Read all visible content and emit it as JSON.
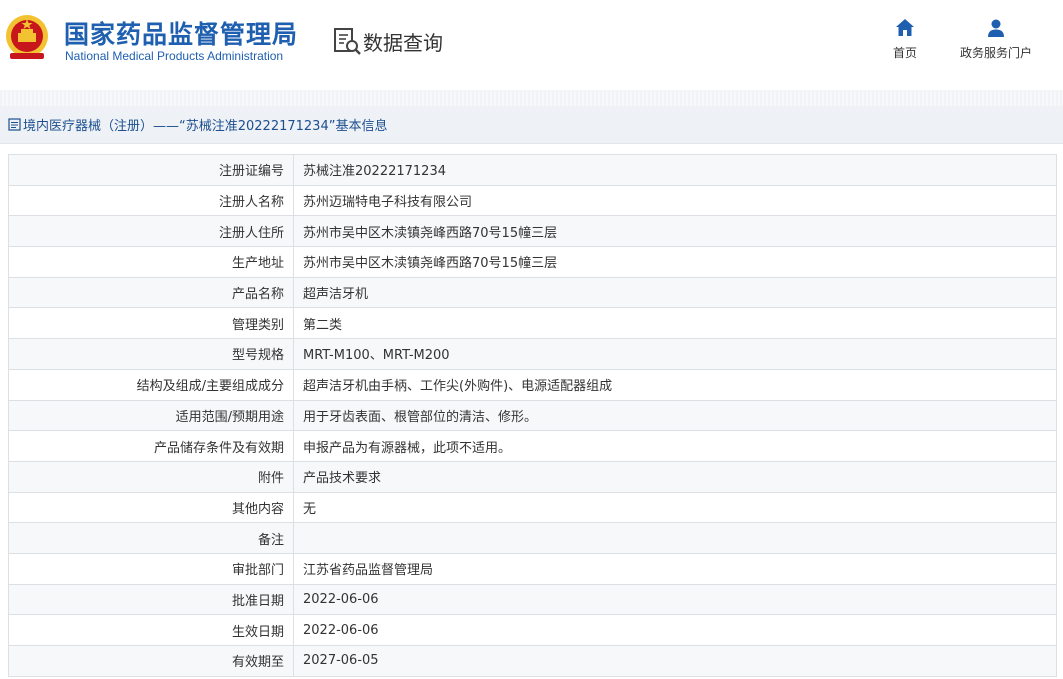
{
  "header": {
    "org_name_cn": "国家药品监督管理局",
    "org_name_en": "National Medical Products Administration",
    "query_label": "数据查询",
    "nav_home": "首页",
    "nav_portal": "政务服务门户"
  },
  "breadcrumb": {
    "text": "境内医疗器械（注册）——“苏械注准20222171234”基本信息"
  },
  "colors": {
    "brand_blue": "#1f5fb0",
    "emblem_red": "#c8161d",
    "emblem_gold": "#f2c230"
  },
  "icons": [
    "national-emblem-icon",
    "data-query-icon",
    "home-icon",
    "user-icon",
    "document-icon"
  ],
  "record": {
    "rows": [
      {
        "label": "注册证编号",
        "value": "苏械注准20222171234"
      },
      {
        "label": "注册人名称",
        "value": "苏州迈瑞特电子科技有限公司"
      },
      {
        "label": "注册人住所",
        "value": "苏州市吴中区木渎镇尧峰西路70号15幢三层"
      },
      {
        "label": "生产地址",
        "value": "苏州市吴中区木渎镇尧峰西路70号15幢三层"
      },
      {
        "label": "产品名称",
        "value": "超声洁牙机"
      },
      {
        "label": "管理类别",
        "value": "第二类"
      },
      {
        "label": "型号规格",
        "value": "MRT-M100、MRT-M200"
      },
      {
        "label": "结构及组成/主要组成成分",
        "value": "超声洁牙机由手柄、工作尖(外购件)、电源适配器组成"
      },
      {
        "label": "适用范围/预期用途",
        "value": "用于牙齿表面、根管部位的清洁、修形。"
      },
      {
        "label": "产品储存条件及有效期",
        "value": "申报产品为有源器械，此项不适用。"
      },
      {
        "label": "附件",
        "value": "产品技术要求"
      },
      {
        "label": "其他内容",
        "value": "无"
      },
      {
        "label": "备注",
        "value": ""
      },
      {
        "label": "审批部门",
        "value": "江苏省药品监督管理局"
      },
      {
        "label": "批准日期",
        "value": "2022-06-06"
      },
      {
        "label": "生效日期",
        "value": "2022-06-06"
      },
      {
        "label": "有效期至",
        "value": "2027-06-05"
      }
    ]
  }
}
